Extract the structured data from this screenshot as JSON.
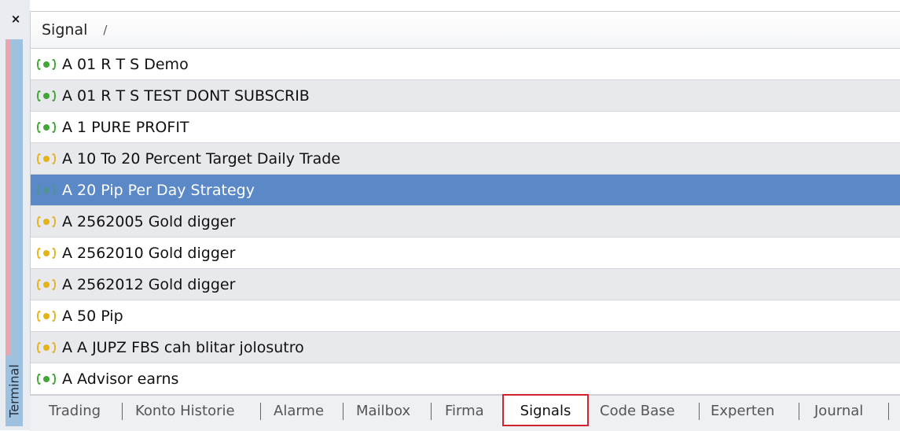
{
  "window": {
    "panel_title": "Terminal",
    "close_glyph": "×"
  },
  "grid": {
    "column_header": "Signal",
    "sort_indicator": "/",
    "rows": [
      {
        "name": "A 01 R T S Demo",
        "status": "green"
      },
      {
        "name": "A 01 R T S TEST DONT SUBSCRIB",
        "status": "green"
      },
      {
        "name": "A 1 PURE PROFIT",
        "status": "green"
      },
      {
        "name": "A 10 To 20 Percent Target Daily Trade",
        "status": "yellow"
      },
      {
        "name": "A 20 Pip Per Day Strategy",
        "status": "green",
        "selected": true
      },
      {
        "name": "A 2562005 Gold digger",
        "status": "yellow"
      },
      {
        "name": "A 2562010 Gold digger",
        "status": "yellow"
      },
      {
        "name": "A 2562012 Gold digger",
        "status": "yellow"
      },
      {
        "name": "A 50 Pip",
        "status": "yellow"
      },
      {
        "name": "A A JUPZ FBS cah blitar jolosutro",
        "status": "yellow"
      },
      {
        "name": "A Advisor earns",
        "status": "green"
      }
    ]
  },
  "tabs": [
    {
      "label": "Trading"
    },
    {
      "label": "Konto Historie"
    },
    {
      "label": "Alarme"
    },
    {
      "label": "Mailbox"
    },
    {
      "label": "Firma"
    },
    {
      "label": "Signals",
      "active": true
    },
    {
      "label": "Code Base"
    },
    {
      "label": "Experten"
    },
    {
      "label": "Journal"
    }
  ],
  "colors": {
    "green": "#3fa535",
    "yellow": "#e3b21c",
    "selected_row": "#5b88c7",
    "active_tab_border": "#d1242f"
  }
}
